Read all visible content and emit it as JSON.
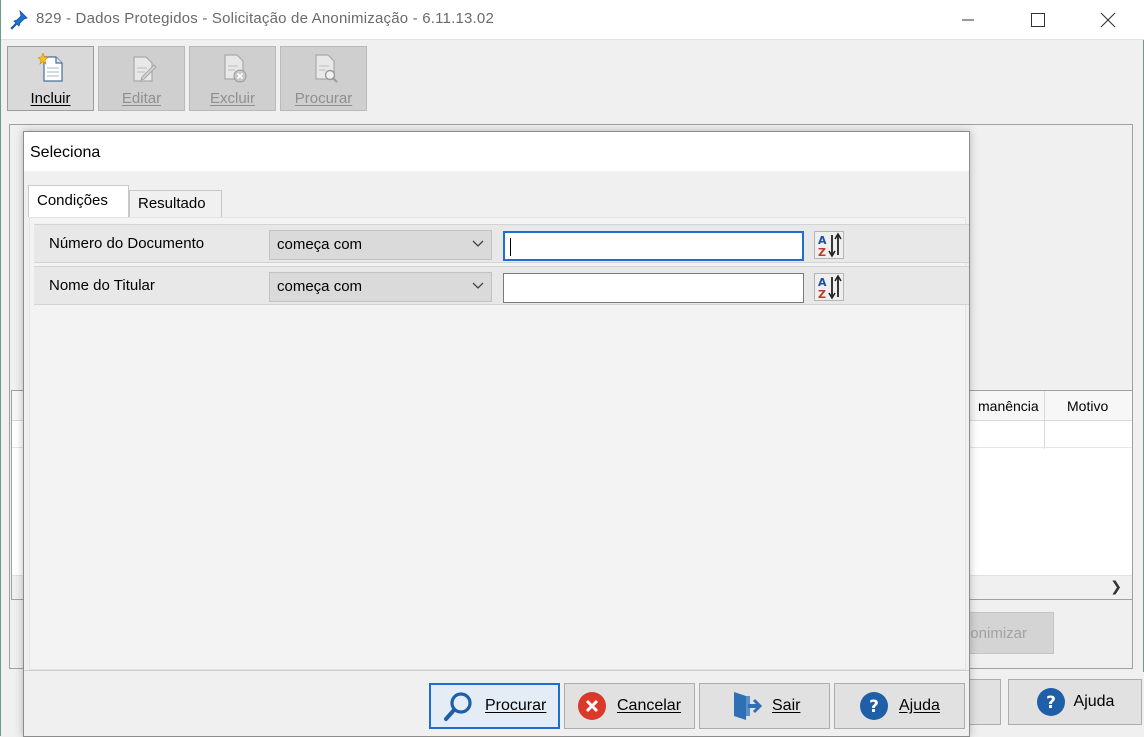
{
  "window": {
    "title": "829 - Dados Protegidos - Solicitação de Anonimização - 6.11.13.02",
    "app_icon": "pin-icon"
  },
  "toolbar": {
    "items": [
      {
        "label": "Incluir",
        "icon": "new-document-icon",
        "enabled": true
      },
      {
        "label": "Editar",
        "icon": "edit-document-icon",
        "enabled": false
      },
      {
        "label": "Excluir",
        "icon": "delete-document-icon",
        "enabled": false
      },
      {
        "label": "Procurar",
        "icon": "search-document-icon",
        "enabled": false
      }
    ]
  },
  "background": {
    "grid_columns": [
      "manência",
      "Motivo"
    ],
    "anonymize_button": "onimizar",
    "help_button": "Ajuda"
  },
  "dialog": {
    "title": "Seleciona",
    "tabs": [
      "Condições",
      "Resultado"
    ],
    "active_tab": "Condições",
    "conditions": [
      {
        "label": "Número do Documento",
        "operator": "começa com",
        "value": "",
        "focused": true
      },
      {
        "label": "Nome do Titular",
        "operator": "começa com",
        "value": "",
        "focused": false
      }
    ],
    "buttons": {
      "search": "Procurar",
      "cancel": "Cancelar",
      "exit": "Sair",
      "help": "Ajuda"
    }
  },
  "colors": {
    "accent_blue": "#1e6fd0",
    "cancel_red": "#d9382b",
    "help_blue": "#1f5fa8",
    "window_bg": "#f0f0f0"
  }
}
